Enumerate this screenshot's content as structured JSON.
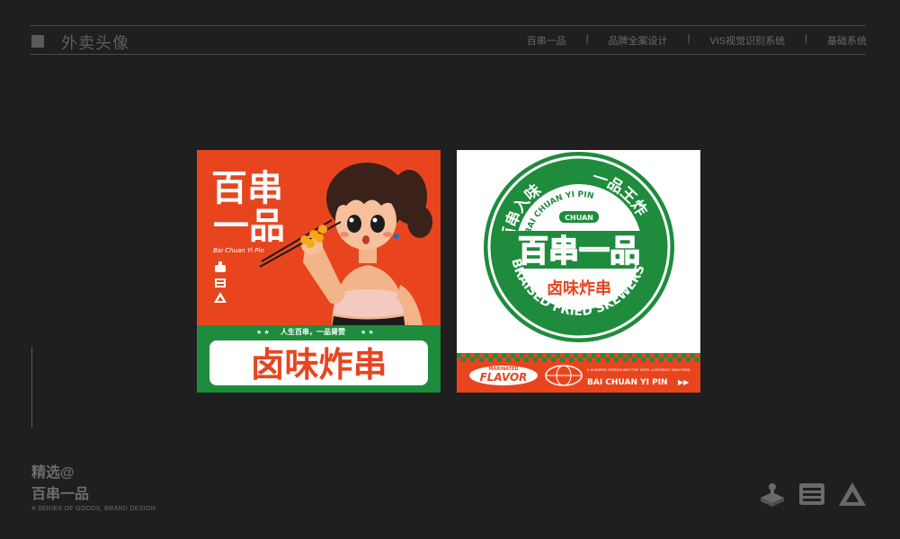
{
  "header": {
    "title": "外卖头像",
    "nav": [
      "百串一品",
      "品牌全案设计",
      "VIS视觉识别系统",
      "基础系统"
    ],
    "separator": "|"
  },
  "card1": {
    "brand_cn_top": "百串",
    "brand_cn_bottom": "一品",
    "brand_pinyin": "Bai Chuan Yi Pin",
    "slogan": "人生百串，一品肾赞",
    "product": "卤味炸串",
    "colors": {
      "bg": "#e8451f",
      "green": "#1e8c3c"
    }
  },
  "card2": {
    "ring_top_left": "百串入味",
    "ring_top_right": "一品王炸",
    "pinyin_arc": "BAI CHUAN YI PIN",
    "chuan_badge": "CHUAN",
    "brand_cn": "百串一品",
    "product": "卤味炸串",
    "bottom_arc": "BRAISED FRIED SKEWERS",
    "marinated": "MARINATED",
    "flavor": "FLAVOR",
    "tagline": "A HUNDRED STRINGS INTO THE TASTE, A PRODUCT KING FRIED",
    "pinyin_footer": "BAI CHUAN YI PIN",
    "colors": {
      "green": "#1e8c3c",
      "orange": "#e8451f"
    }
  },
  "footer": {
    "line1": "精选@",
    "line2": "百串一品",
    "line3": "A SERIES OF GOODS, BRAND DESIGN"
  }
}
